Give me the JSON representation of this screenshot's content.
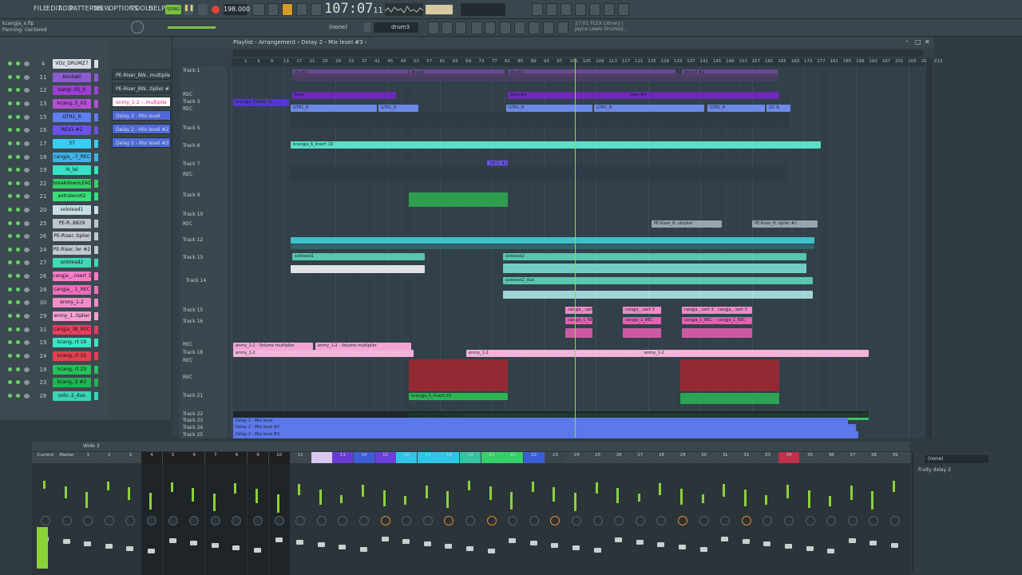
{
  "menu": [
    "FILE",
    "EDIT",
    "ADD",
    "PATTERNS",
    "VIEW",
    "OPTIONS",
    "TOOLS",
    "HELP"
  ],
  "transport": {
    "mode_label": "SONG",
    "bpm": "198.000",
    "time": "107:07",
    "time_sub": "11",
    "pattern": "drum3",
    "none_label": "(none)"
  },
  "hint": {
    "file": "kcangja_x.flp",
    "action": "Panning: Centered"
  },
  "news": {
    "line1": "27:01  FLEX Library |",
    "line2": "Jayce Lewis Drumsic.."
  },
  "playlist": {
    "title": "Playlist - Arrangement › Delay 2 - Mix level #3 ›"
  },
  "ruler": [
    "1",
    "5",
    "9",
    "13",
    "17",
    "21",
    "25",
    "29",
    "33",
    "37",
    "41",
    "45",
    "49",
    "53",
    "57",
    "61",
    "65",
    "69",
    "73",
    "77",
    "81",
    "85",
    "89",
    "93",
    "97",
    "101",
    "105",
    "109",
    "113",
    "117",
    "121",
    "125",
    "129",
    "133",
    "137",
    "141",
    "145",
    "149",
    "153",
    "157",
    "161",
    "165",
    "169",
    "173",
    "177",
    "181",
    "185",
    "189",
    "193",
    "197",
    "201",
    "205",
    "209",
    "213"
  ],
  "pickers": [
    "PE-Riser_BW...multiplier",
    "PE-Riser_BW...tiplier #2",
    "enmy_1-2 -..multiplie",
    "Delay 2 - Mix level",
    "Delay 2 - Mix level #2",
    "Delay 2 - Mix level #3"
  ],
  "channels": [
    {
      "num": "4",
      "name": "VOz_DRUMZ7",
      "color": "#d6dde0"
    },
    {
      "num": "11",
      "name": "Kontakt",
      "color": "#8a5ccf"
    },
    {
      "num": "12",
      "name": "kangi..01_II",
      "color": "#9b3fd1"
    },
    {
      "num": "13",
      "name": "kcang..5_01",
      "color": "#b24fd3"
    },
    {
      "num": "15",
      "name": "GTR1_R",
      "color": "#5f7ff0"
    },
    {
      "num": "16",
      "name": "REV1 #2",
      "color": "#6a52e8"
    },
    {
      "num": "17",
      "name": "37",
      "color": "#38cdf2"
    },
    {
      "num": "18",
      "name": "cangja_..7_REC",
      "color": "#3fb2e8"
    },
    {
      "num": "19",
      "name": "hi_lel",
      "color": "#39e0c6"
    },
    {
      "num": "22",
      "name": "breakdownLEAD",
      "color": "#35d06a"
    },
    {
      "num": "21",
      "name": "extralenot2",
      "color": "#3ddd7a"
    },
    {
      "num": "20",
      "name": "sololead1",
      "color": "#c7dfe4"
    },
    {
      "num": "25",
      "name": "PE-R..8829",
      "color": "#bfc6cc"
    },
    {
      "num": "26",
      "name": "PE-Riser..tiplier",
      "color": "#c1c8ce"
    },
    {
      "num": "24",
      "name": "PE-Riser..ler #2",
      "color": "#c1c8ce"
    },
    {
      "num": "27",
      "name": "sololead2",
      "color": "#3fd9b9"
    },
    {
      "num": "26",
      "name": "cangja_..nsert 3",
      "color": "#f77ec9"
    },
    {
      "num": "28",
      "name": "cangja_..1_REC",
      "color": "#f06fbd"
    },
    {
      "num": "30",
      "name": "enmy_1-2",
      "color": "#f48cc9"
    },
    {
      "num": "29",
      "name": "enmy_1..tiplier",
      "color": "#f3a2d2"
    },
    {
      "num": "31",
      "name": "cangja_38_REC",
      "color": "#ea3f5d"
    },
    {
      "num": "19",
      "name": "kcang..rt 19",
      "color": "#39e6c4"
    },
    {
      "num": "24",
      "name": "kcang..rt 22",
      "color": "#e0414f"
    },
    {
      "num": "18",
      "name": "kcang..rt 23",
      "color": "#26c259"
    },
    {
      "num": "23",
      "name": "kcang..3 #2",
      "color": "#22b352"
    },
    {
      "num": "26",
      "name": "solo..2_duo",
      "color": "#3bd3b5"
    }
  ],
  "tracks": [
    {
      "label": "Track 1"
    },
    {
      "label": "REC"
    },
    {
      "label": "Track 3"
    },
    {
      "label": "REC"
    },
    {
      "label": "Track 5"
    },
    {
      "label": "Track 6"
    },
    {
      "label": "Track 7"
    },
    {
      "label": "REC"
    },
    {
      "label": "Track 9"
    },
    {
      "label": "Track 10"
    },
    {
      "label": "REC"
    },
    {
      "label": "Track 12"
    },
    {
      "label": "Track 13"
    },
    {
      "label": "Track 14"
    },
    {
      "label": "Track 15"
    },
    {
      "label": "Track 16"
    },
    {
      "label": "REC"
    },
    {
      "label": "Track 18"
    },
    {
      "label": "REC"
    },
    {
      "label": "REC"
    },
    {
      "label": "Track 21"
    },
    {
      "label": "Track 22"
    },
    {
      "label": "Track 23"
    },
    {
      "label": "Track 24"
    },
    {
      "label": "Track 25"
    }
  ],
  "clips": [
    {
      "label": "drum1",
      "color": "#6b4a8f"
    },
    {
      "label": "drum2",
      "color": "#6b4a8f"
    },
    {
      "label": "drum3",
      "color": "#6b4a8f"
    },
    {
      "label": "drum7 #2",
      "color": "#6b4a8f"
    },
    {
      "label": "bass",
      "color": "#6c2ab5"
    },
    {
      "label": "bass #2",
      "color": "#6c2ab5"
    },
    {
      "label": "bass #3",
      "color": "#6c2ab5"
    },
    {
      "label": "kcangja_FBASS_01",
      "color": "#5436d6"
    },
    {
      "label": "GTR1_R",
      "color": "#6d8ae8"
    },
    {
      "label": "GTR1_R",
      "color": "#6d8ae8"
    },
    {
      "label": "GTR1_R",
      "color": "#6d8ae8"
    },
    {
      "label": "GTR1_R",
      "color": "#6d8ae8"
    },
    {
      "label": "GTR1_R",
      "color": "#6d8ae8"
    },
    {
      "label": "GT..R",
      "color": "#6d8ae8"
    },
    {
      "label": "kcangja_6_Insert 19",
      "color": "#59e0c6"
    },
    {
      "label": "REV1 #2",
      "color": "#6f55f0"
    },
    {
      "label": "kcangja_6_Insert 23 #2",
      "color": "#39c45c"
    },
    {
      "label": "enmy_1-2 - Volume multiplier",
      "color": "#f2a6d6"
    },
    {
      "label": "enmy_1-2 - Volume multiplier",
      "color": "#f2a6d6"
    },
    {
      "label": "enmy_1-2",
      "color": "#f3b3da"
    },
    {
      "label": "enmy_1-2",
      "color": "#f3b3da"
    },
    {
      "label": "enmy_1-2",
      "color": "#f3b3da"
    },
    {
      "label": "kcangja_6_Insert 23",
      "color": "#2db552"
    },
    {
      "label": "Delay 2 - Mix level",
      "color": "#5c78ea"
    },
    {
      "label": "Delay 2 - Mix level #2",
      "color": "#5c78ea"
    },
    {
      "label": "Delay 2 - Mix level #3",
      "color": "#5c78ea"
    },
    {
      "label": "PE-Riser_B..ultiplier",
      "color": "#99a5ab"
    },
    {
      "label": "PE-Riser_B..tiplier #2",
      "color": "#99a5ab"
    },
    {
      "label": "sololead1",
      "color": "#58c7b0"
    },
    {
      "label": "sololead2",
      "color": "#58c7b0"
    },
    {
      "label": "sololead2_duo",
      "color": "#58c7b0"
    },
    {
      "label": "cangja_..sert 3",
      "color": "#f08ac6"
    },
    {
      "label": "cangja_..sert 3",
      "color": "#f08ac6"
    },
    {
      "label": "cangja_..sert 3",
      "color": "#f08ac6"
    },
    {
      "label": "cangja_..sert 3",
      "color": "#f08ac6"
    },
    {
      "label": "cangja_1_REC",
      "color": "#e85fb2"
    },
    {
      "label": "cangja_1_REC",
      "color": "#e85fb2"
    },
    {
      "label": "cangja_1_REC",
      "color": "#e85fb2"
    },
    {
      "label": "cangja_1_REC",
      "color": "#e85fb2"
    }
  ],
  "mixer": {
    "title": "Wide 3",
    "strips": [
      "Current",
      "Master",
      "1",
      "2",
      "3",
      "4",
      "5",
      "6",
      "7",
      "8",
      "9",
      "10",
      "11",
      "12",
      "13",
      "14",
      "15",
      "16",
      "17",
      "18",
      "19",
      "20",
      "21",
      "22",
      "23",
      "24",
      "25",
      "26",
      "27",
      "28",
      "29",
      "30",
      "31",
      "32",
      "33",
      "34",
      "35",
      "36",
      "37",
      "38",
      "39"
    ],
    "none_label": "(none)",
    "fx_slot": "Fruity delay 2"
  }
}
